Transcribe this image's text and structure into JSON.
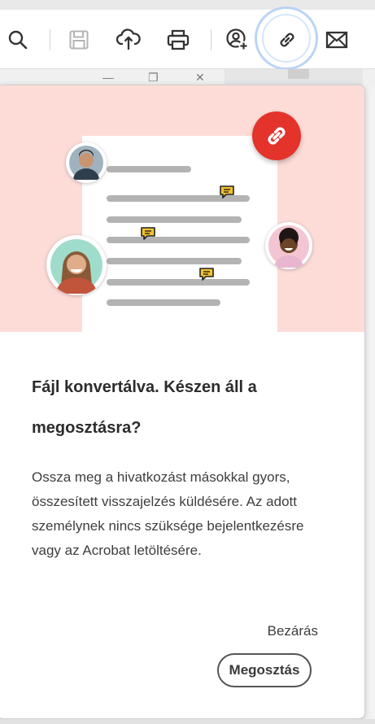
{
  "toolbar": {
    "icons": [
      "search-icon",
      "save-icon",
      "upload-cloud-icon",
      "print-icon",
      "add-user-icon",
      "link-icon",
      "mail-icon"
    ],
    "active_icon": "link-icon"
  },
  "window_controls": {
    "minimize": "—",
    "restore": "❐",
    "close": "✕"
  },
  "popover": {
    "title": "Fájl konvertálva. Készen áll a megosztásra?",
    "body": "Ossza meg a hivatkozást másokkal gyors, összesített visszajelzés küldésére. Az adott személynek nincs szüksége bejelentkezésre vagy az Acrobat letöltésére.",
    "close_label": "Bezárás",
    "share_label": "Megosztás"
  },
  "colors": {
    "hero_background": "#fddcd8",
    "link_badge": "#e4332a",
    "comment_bubble": "#f2c12e",
    "focus_ring": "#b9d4f5"
  }
}
